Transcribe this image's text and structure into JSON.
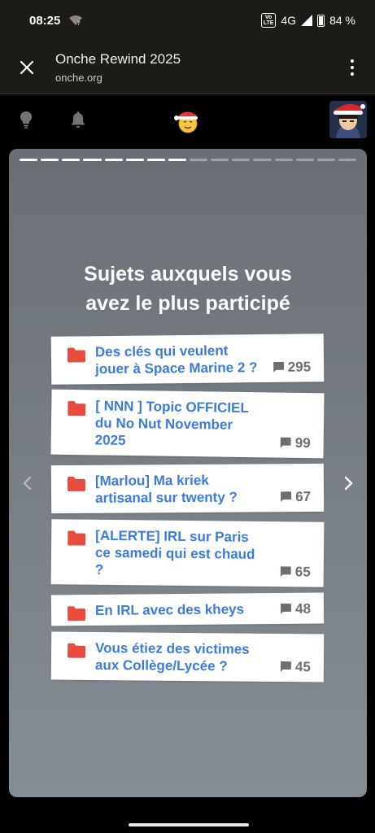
{
  "status_bar": {
    "time": "08:25",
    "volte_line1": "Vo",
    "volte_line2": "LTE",
    "network": "4G",
    "battery": "84 %"
  },
  "browser": {
    "title": "Onche Rewind 2025",
    "url": "onche.org"
  },
  "nav_icons": [
    "lightbulb-icon",
    "bell-icon",
    "santa-smiley-logo",
    "user-avatar"
  ],
  "story": {
    "progress_total": 16,
    "progress_active": 8,
    "heading_line1": "Sujets auxquels vous",
    "heading_line2": "avez le plus participé",
    "topics": [
      {
        "title": "Des clés qui veulent jouer à Space Marine 2 ?",
        "count": "295"
      },
      {
        "title": "[ NNN ] Topic OFFICIEL du No Nut November 2025",
        "count": "99"
      },
      {
        "title": "[Marlou] Ma kriek artisanal sur twenty ?",
        "count": "67"
      },
      {
        "title": "[ALERTE] IRL sur Paris ce samedi qui est chaud ?",
        "count": "65"
      },
      {
        "title": "En IRL avec des kheys",
        "count": "48"
      },
      {
        "title": "Vous étiez des victimes aux Collège/Lycée ?",
        "count": "45"
      }
    ]
  },
  "colors": {
    "topic_link": "#3a7be0",
    "folder": "#e74c3c",
    "card_top": "#6a7075",
    "card_bottom": "#858d94",
    "bar_bg": "#1d1b17"
  }
}
